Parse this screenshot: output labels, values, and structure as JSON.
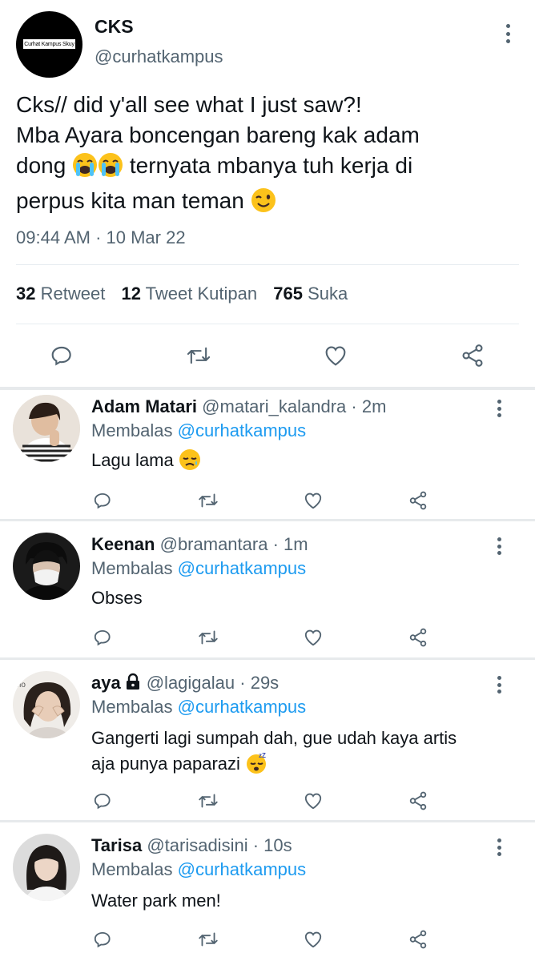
{
  "main_tweet": {
    "avatar_logo_text": "Curhat Kampus Skuy",
    "name": "CKS",
    "handle": "@curhatkampus",
    "text_lines": [
      "Cks// did y'all see what I just saw?!",
      "Mba Ayara boncengan bareng kak adam",
      "dong",
      "ternyata mbanya tuh kerja di",
      "perpus kita man teman"
    ],
    "time": "09:44 AM · 10 Mar 22",
    "stats": {
      "retweets_count": "32",
      "retweets_label": "Retweet",
      "quotes_count": "12",
      "quotes_label": "Tweet Kutipan",
      "likes_count": "765",
      "likes_label": "Suka"
    }
  },
  "replies": [
    {
      "name": "Adam Matari",
      "handle": "@matari_kalandra",
      "time": "· 2m",
      "replying_prefix": "Membalas",
      "replying_to": "@curhatkampus",
      "text_lines": [
        "Lagu lama"
      ],
      "emoji": "sad-face"
    },
    {
      "name": "Keenan",
      "handle": "@bramantara",
      "time": "· 1m",
      "replying_prefix": "Membalas",
      "replying_to": "@curhatkampus",
      "text_lines": [
        "Obses"
      ]
    },
    {
      "name": "aya",
      "handle": "@lagigalau",
      "time": "· 29s",
      "replying_prefix": "Membalas",
      "replying_to": "@curhatkampus",
      "text_lines": [
        "Gangerti lagi sumpah dah, gue udah kaya artis",
        "aja punya paparazi"
      ],
      "protected": true,
      "emoji": "sleeping-face"
    },
    {
      "name": "Tarisa",
      "handle": "@tarisadisini",
      "time": "· 10s",
      "replying_prefix": "Membalas",
      "replying_to": "@curhatkampus",
      "text_lines": [
        "Water park men!"
      ]
    }
  ],
  "colors": {
    "text": "#0f1419",
    "secondary": "#536471",
    "link": "#1d9bf0",
    "divider": "#e6ecf0"
  }
}
